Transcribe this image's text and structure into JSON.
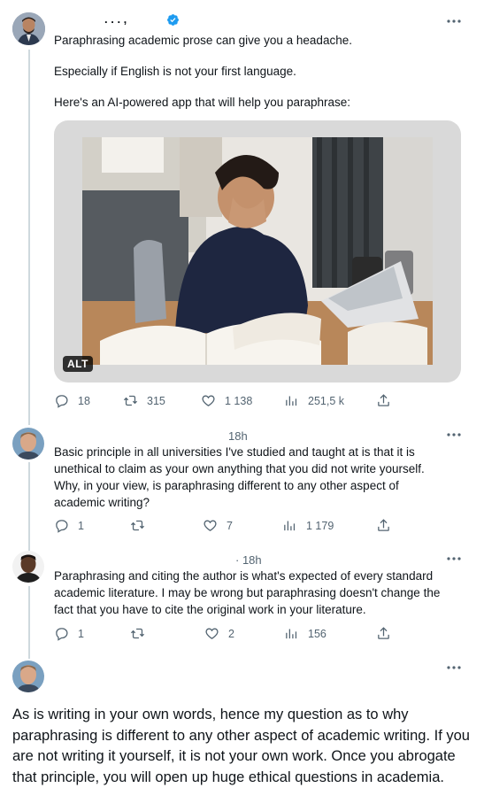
{
  "tweets": [
    {
      "author_name": ". . . ,",
      "text": [
        "Paraphrasing academic prose can give you a headache.",
        "Especially if English is not your first language.",
        "Here's an AI-powered app that will help you paraphrase:"
      ],
      "media_alt_badge": "ALT",
      "stats": {
        "replies": "18",
        "retweets": "315",
        "likes": "1 138",
        "views": "251,5 k"
      }
    },
    {
      "time": "18h",
      "text": "Basic principle in all universities I've studied and taught at is that it is unethical to claim as your own anything that you did not write yourself. Why, in your view, is paraphrasing different to any other aspect of academic writing?",
      "stats": {
        "replies": "1",
        "retweets": "",
        "likes": "7",
        "views": "1 179"
      }
    },
    {
      "time": "· 18h",
      "text": "Paraphrasing and citing the author is what's expected of every standard academic literature. I may be wrong but paraphrasing doesn't change the fact that you have to cite the original work in your literature.",
      "stats": {
        "replies": "1",
        "retweets": "",
        "likes": "2",
        "views": "156"
      }
    },
    {
      "text": "As is writing in your own words, hence my question as to why paraphrasing is different to any other aspect of academic writing. If you are not writing it yourself, it is not your own work. Once you abrogate that principle, you will open up huge ethical questions in academia."
    }
  ],
  "colors": {
    "verified": "#1d9bf0",
    "muted": "#536471",
    "thread_line": "#cfd9de"
  }
}
